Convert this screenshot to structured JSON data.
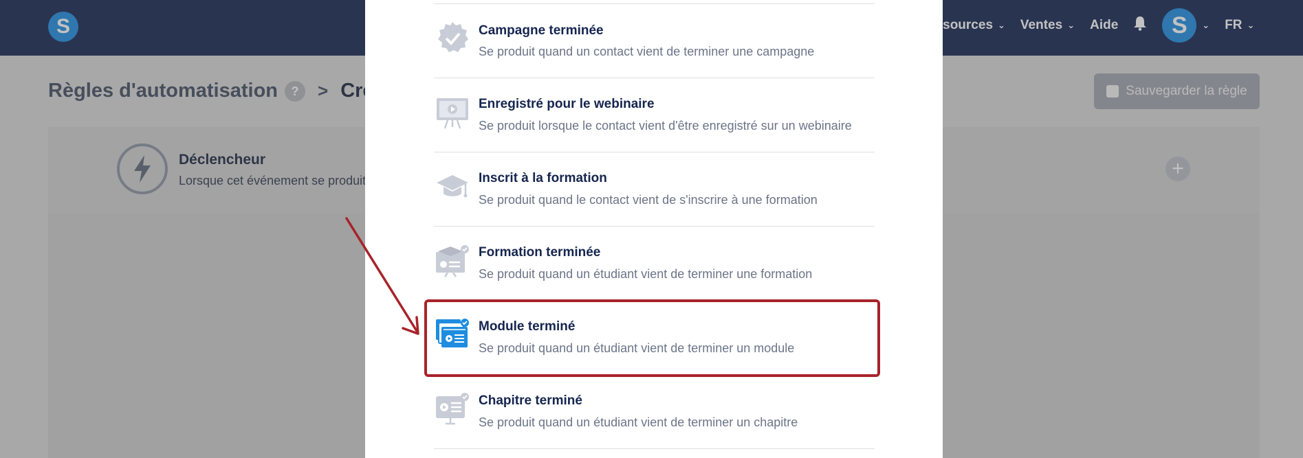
{
  "header": {
    "logo_letter": "S",
    "menu": [
      {
        "label": "essources"
      },
      {
        "label": "Ventes"
      },
      {
        "label": "Aide"
      }
    ],
    "avatar_letter": "S",
    "language": "FR"
  },
  "page": {
    "breadcrumb_root": "Règles d'automatisation",
    "help_badge": "?",
    "breadcrumb_separator": ">",
    "breadcrumb_current": "Crée",
    "save_label": "Sauvegarder la règle",
    "trigger_title": "Déclencheur",
    "trigger_desc": "Lorsque cet événement se produit",
    "add_symbol": "+"
  },
  "modal": {
    "items": [
      {
        "title": "Campagne terminée",
        "desc": "Se produit quand un contact vient de terminer une campagne",
        "icon": "badge-check-icon"
      },
      {
        "title": "Enregistré pour le webinaire",
        "desc": "Se produit lorsque le contact vient d'être enregistré sur un webinaire",
        "icon": "presentation-board-icon"
      },
      {
        "title": "Inscrit à la formation",
        "desc": "Se produit quand le contact vient de s'inscrire à une formation",
        "icon": "graduation-cap-icon"
      },
      {
        "title": "Formation terminée",
        "desc": "Se produit quand un étudiant vient de terminer une formation",
        "icon": "course-complete-icon"
      },
      {
        "title": "Module terminé",
        "desc": "Se produit quand un étudiant vient de terminer un module",
        "icon": "module-complete-icon"
      },
      {
        "title": "Chapitre terminé",
        "desc": "Se produit quand un étudiant vient de terminer un chapitre",
        "icon": "chapter-complete-icon"
      }
    ],
    "highlighted_item": "Module terminé"
  },
  "colors": {
    "navbar": "#142552",
    "brand_blue": "#1e8de0",
    "highlight_red": "#a8232a",
    "inactive_icon": "#c8ccd6"
  }
}
